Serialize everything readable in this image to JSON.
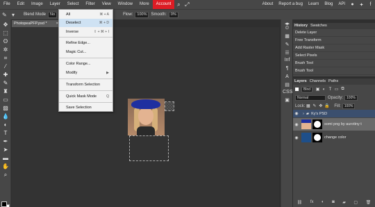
{
  "menubar": {
    "items": [
      "File",
      "Edit",
      "Image",
      "Layer",
      "Select",
      "Filter",
      "View",
      "Window",
      "More",
      "Account"
    ],
    "right": [
      "About",
      "Report a bug",
      "Learn",
      "Blog",
      "API"
    ]
  },
  "options": {
    "blend_label": "Blend Mode",
    "blend_value": "No",
    "flow_label": "Flow:",
    "flow_value": "100%",
    "smooth_label": "Smooth:",
    "smooth_value": "0%"
  },
  "doc_tab": {
    "name": "PhotopeaPFP.psd *",
    "close": "×"
  },
  "select_menu": [
    {
      "label": "All",
      "shortcut": "⌘ + A"
    },
    {
      "label": "Deselect",
      "shortcut": "⌘ + D"
    },
    {
      "label": "Inverse",
      "shortcut": "⇧ + ⌘ + I"
    },
    {
      "label": "Refine Edge..."
    },
    {
      "label": "Magic Cut..."
    },
    {
      "label": "Color Range..."
    },
    {
      "label": "Modify",
      "shortcut": "▶"
    },
    {
      "label": "Transform Selection"
    },
    {
      "label": "Quick Mask Mode",
      "shortcut": "Q"
    },
    {
      "label": "Save Selection"
    }
  ],
  "history": {
    "tabs": [
      "History",
      "Swatches"
    ],
    "items": [
      "Delete Layer",
      "Free Transform",
      "Add Raster Mask",
      "Select Pixels",
      "Brush Tool",
      "Brush Tool"
    ]
  },
  "side_icons": [
    "Inf",
    "¶",
    "CSS"
  ],
  "layers": {
    "tabs": [
      "Layers",
      "Channels",
      "Paths"
    ],
    "filter_label": "Blnd",
    "blend_mode": "Normal",
    "opacity_label": "Opacity:",
    "opacity_value": "100%",
    "lock_label": "Lock:",
    "fill_label": "Fill:",
    "fill_value": "100%",
    "items": [
      {
        "name": "Ky's PSD",
        "type": "folder"
      },
      {
        "name": "somi png by aurotiny t",
        "type": "image"
      },
      {
        "name": "change color",
        "type": "fill",
        "color": "#1e4f8a"
      }
    ]
  },
  "colors": {
    "accent": "#dd1c24",
    "hover": "#cfe2f3",
    "panel": "#474747",
    "canvas": "#333333"
  }
}
